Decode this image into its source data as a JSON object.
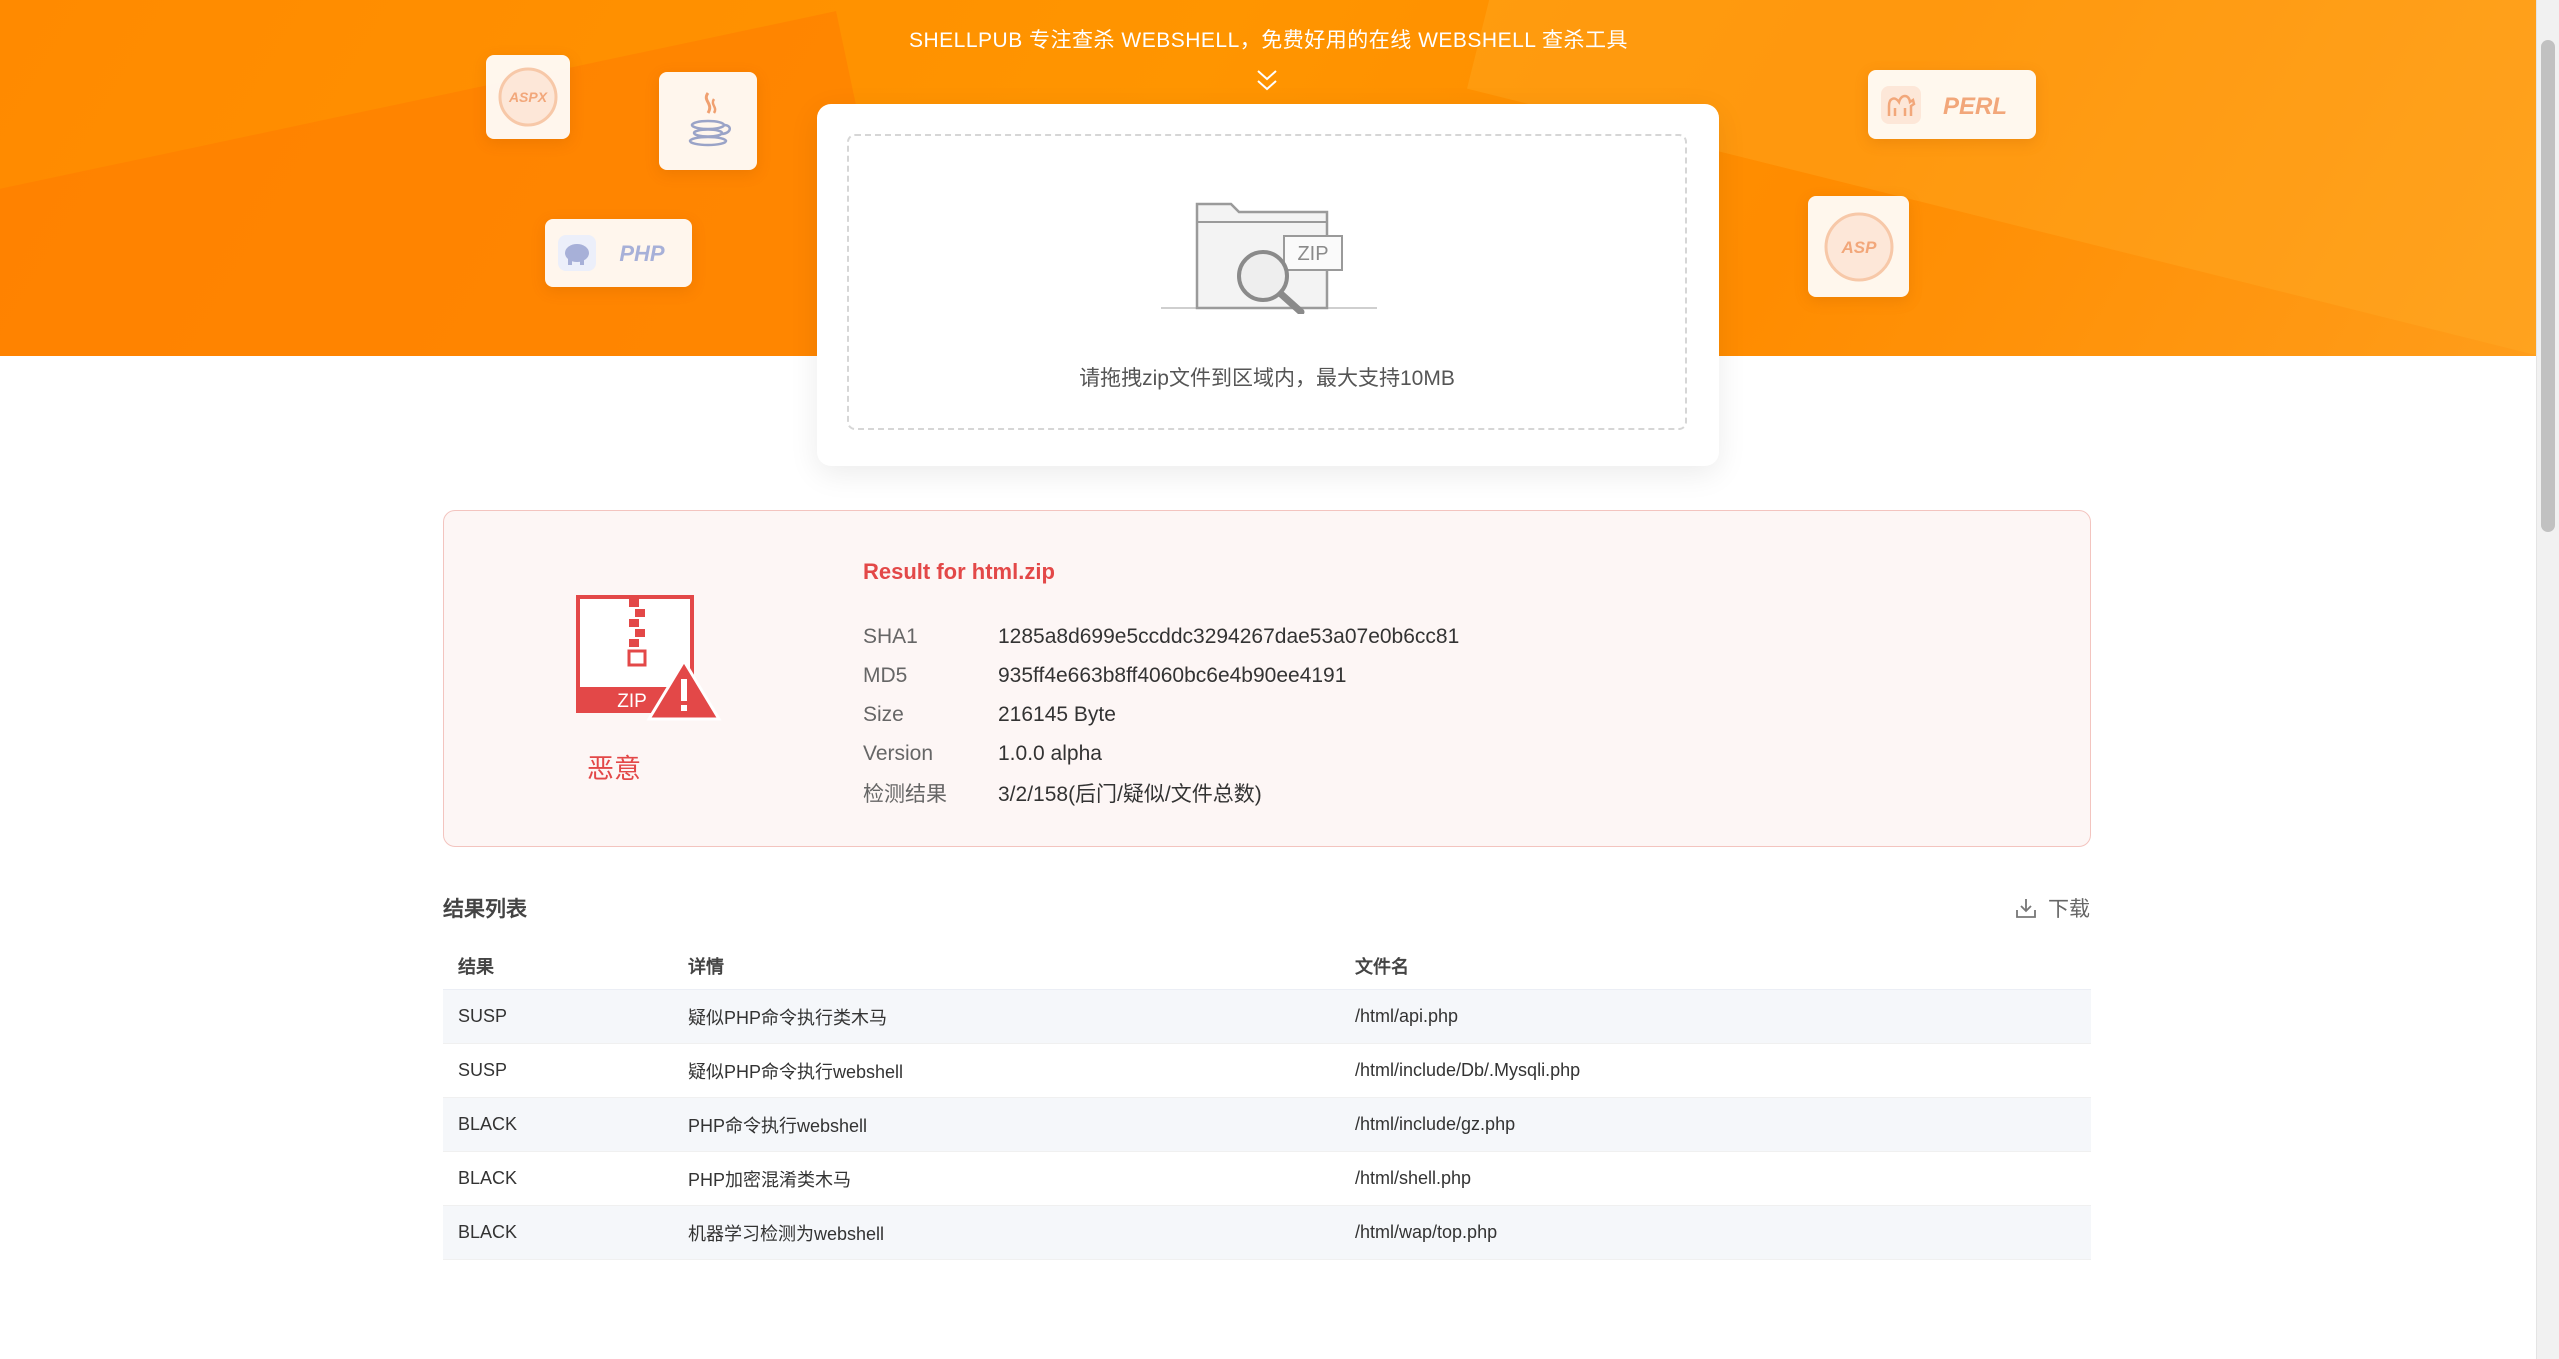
{
  "hero": {
    "subtitle": "SHELLPUB 专注查杀 WEBSHELL，免费好用的在线 WEBSHELL 查杀工具",
    "languages": {
      "aspx": "ASPX",
      "php": "PHP",
      "perl": "PERL",
      "asp": "ASP"
    },
    "colors": {
      "primary": "#ff8a00",
      "accent": "#e34848"
    }
  },
  "upload": {
    "illustration_label": "ZIP",
    "hint": "请拖拽zip文件到区域内，最大支持10MB"
  },
  "result": {
    "zip_label": "ZIP",
    "verdict": "恶意",
    "title": "Result for html.zip",
    "fields": [
      {
        "key": "SHA1",
        "value": "1285a8d699e5ccddc3294267dae53a07e0b6cc81"
      },
      {
        "key": "MD5",
        "value": "935ff4e663b8ff4060bc6e4b90ee4191"
      },
      {
        "key": "Size",
        "value": "216145 Byte"
      },
      {
        "key": "Version",
        "value": "1.0.0 alpha"
      },
      {
        "key": "检测结果",
        "value": "3/2/158(后门/疑似/文件总数)"
      }
    ]
  },
  "list": {
    "title": "结果列表",
    "download_label": "下载",
    "columns": [
      "结果",
      "详情",
      "文件名"
    ],
    "rows": [
      {
        "result": "SUSP",
        "detail": "疑似PHP命令执行类木马",
        "file": "/html/api.php"
      },
      {
        "result": "SUSP",
        "detail": "疑似PHP命令执行webshell",
        "file": "/html/include/Db/.Mysqli.php"
      },
      {
        "result": "BLACK",
        "detail": "PHP命令执行webshell",
        "file": "/html/include/gz.php"
      },
      {
        "result": "BLACK",
        "detail": "PHP加密混淆类木马",
        "file": "/html/shell.php"
      },
      {
        "result": "BLACK",
        "detail": "机器学习检测为webshell",
        "file": "/html/wap/top.php"
      }
    ]
  }
}
